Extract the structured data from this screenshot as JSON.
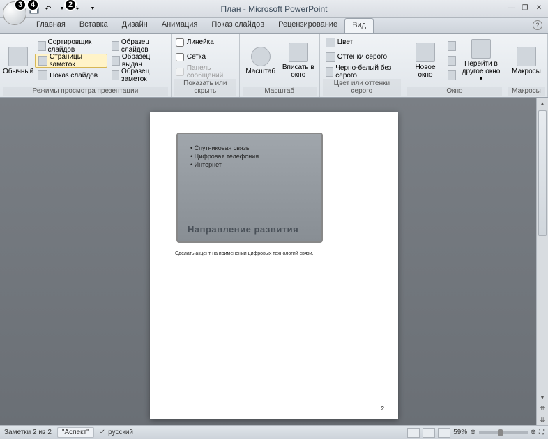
{
  "title": "План - Microsoft PowerPoint",
  "tabs": [
    "Главная",
    "Вставка",
    "Дизайн",
    "Анимация",
    "Показ слайдов",
    "Рецензирование",
    "Вид"
  ],
  "active_tab": 6,
  "ribbon": {
    "g1": {
      "label": "Режимы просмотра презентации",
      "big": "Обычный",
      "items": [
        "Сортировщик слайдов",
        "Страницы заметок",
        "Показ слайдов"
      ],
      "items2": [
        "Образец слайдов",
        "Образец выдач",
        "Образец заметок"
      ],
      "selected": 1
    },
    "g2": {
      "label": "Показать или скрыть",
      "items": [
        "Линейка",
        "Сетка",
        "Панель сообщений"
      ]
    },
    "g3": {
      "label": "Масштаб",
      "b1": "Масштаб",
      "b2": "Вписать в окно"
    },
    "g4": {
      "label": "Цвет или оттенки серого",
      "items": [
        "Цвет",
        "Оттенки серого",
        "Черно-белый без серого"
      ]
    },
    "g5": {
      "label": "Окно",
      "b1": "Новое окно",
      "b2": "Перейти в другое окно"
    },
    "g6": {
      "label": "Макросы",
      "b1": "Макросы"
    }
  },
  "slide": {
    "bullets": [
      "Спутниковая связь",
      "Цифровая телефония",
      "Интернет"
    ],
    "title": "Направление развития",
    "notes": "Сделать акцент на применении цифровых технологий связи.",
    "page_num": "2"
  },
  "status": {
    "left": "Заметки 2 из 2",
    "theme": "\"Аспект\"",
    "lang": "русский",
    "zoom": "59%"
  },
  "callouts": {
    "c2": "2",
    "c3": "3",
    "c4": "4"
  }
}
